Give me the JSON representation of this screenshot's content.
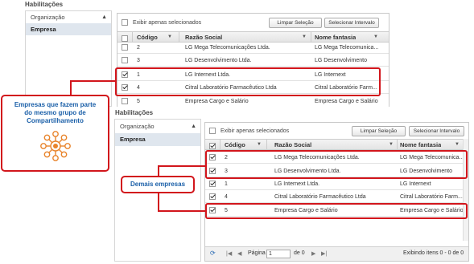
{
  "top": {
    "title": "Habilitações",
    "nav": [
      {
        "label": "Organização",
        "arrow": "▲"
      },
      {
        "label": "Empresa"
      }
    ],
    "show_selected_label": "Exibir apenas selecionados",
    "clear_selection": "Limpar Seleção",
    "select_interval": "Selecionar Intervalo",
    "columns": [
      "Código",
      "Razão Social",
      "Nome fantasia"
    ],
    "rows": [
      {
        "code": "2",
        "name": "LG Mega Telecomunicações Ltda.",
        "fantasy": "LG Mega Telecomunica...",
        "checked": false
      },
      {
        "code": "3",
        "name": "LG Desenvolvimento Ltda.",
        "fantasy": "LG Desenvolvimento",
        "checked": false
      },
      {
        "code": "1",
        "name": "LG Internext Ltda.",
        "fantasy": "LG Internext",
        "checked": true
      },
      {
        "code": "4",
        "name": "Citral Laboratório Farmacêutico Ltda",
        "fantasy": "Citral Laboratório Farm...",
        "checked": true
      },
      {
        "code": "5",
        "name": "Empresa Cargo e Salário",
        "fantasy": "Empresa Cargo e Salário",
        "checked": false
      }
    ]
  },
  "bottom": {
    "title": "Habilitações",
    "nav": [
      {
        "label": "Organização",
        "arrow": "▲"
      },
      {
        "label": "Empresa"
      }
    ],
    "show_selected_label": "Exibir apenas selecionados",
    "clear_selection": "Limpar Seleção",
    "select_interval": "Selecionar Intervalo",
    "columns": [
      "Código",
      "Razão Social",
      "Nome fantasia"
    ],
    "rows": [
      {
        "code": "2",
        "name": "LG Mega Telecomunicações Ltda.",
        "fantasy": "LG Mega Telecomunica...",
        "checked": true
      },
      {
        "code": "3",
        "name": "LG Desenvolvimento Ltda.",
        "fantasy": "LG Desenvolvimento",
        "checked": true
      },
      {
        "code": "1",
        "name": "LG Internext Ltda.",
        "fantasy": "LG Internext",
        "checked": true
      },
      {
        "code": "4",
        "name": "Citral Laboratório Farmacêutico Ltda",
        "fantasy": "Citral Laboratório Farm...",
        "checked": true
      },
      {
        "code": "5",
        "name": "Empresa Cargo e Salário",
        "fantasy": "Empresa Cargo e Salário",
        "checked": true
      }
    ],
    "pager": {
      "page_label": "Página",
      "page_value": "1",
      "of_label": "de 0",
      "display_text": "Exibindo itens 0 - 0 de 0"
    }
  },
  "callout_share": {
    "line1": "Empresas que fazem parte",
    "line2": "do mesmo grupo de",
    "line3": "Compartilhamento"
  },
  "callout_others": {
    "text": "Demais empresas"
  },
  "colors": {
    "red": "#d2161c",
    "blue": "#1a5fa8",
    "orange": "#e8832a"
  }
}
